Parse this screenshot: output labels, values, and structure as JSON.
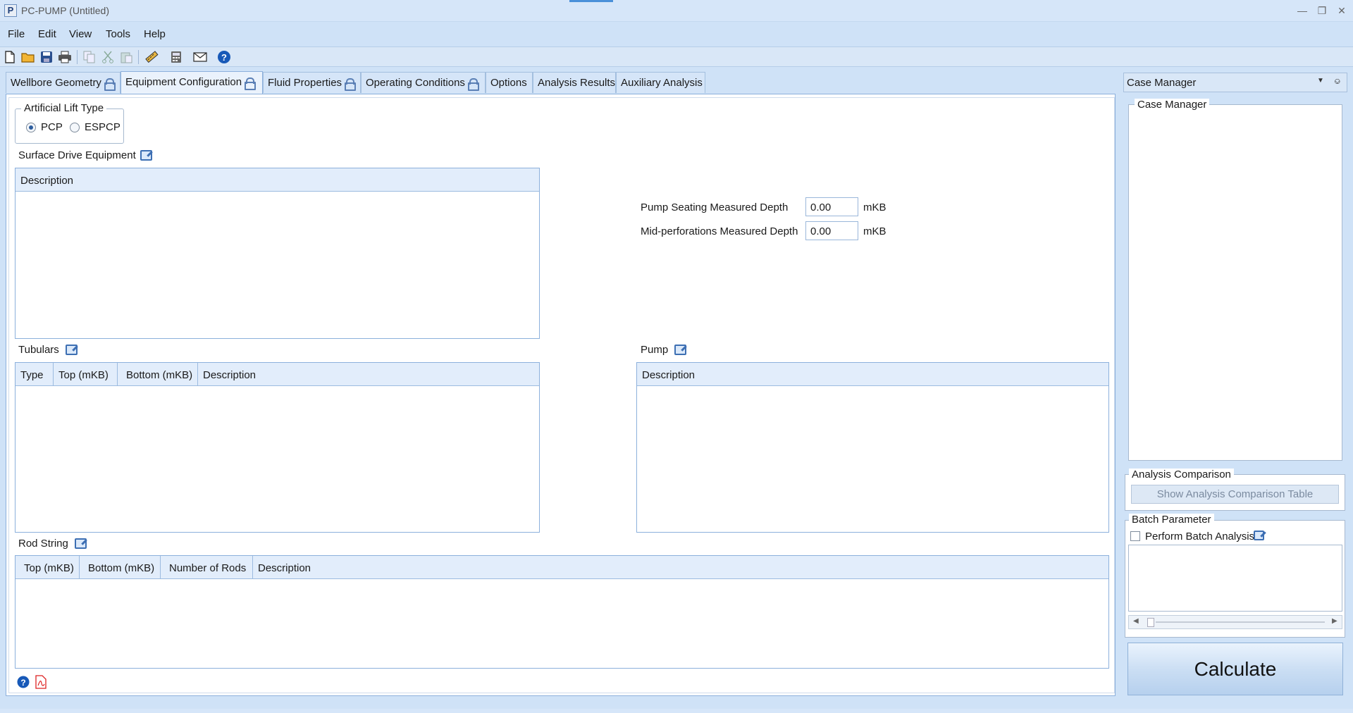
{
  "window": {
    "title": "PC-PUMP (Untitled)",
    "app_letter": "P"
  },
  "menu": [
    "File",
    "Edit",
    "View",
    "Tools",
    "Help"
  ],
  "toolbar_icons": [
    "new-file-icon",
    "open-folder-icon",
    "save-icon",
    "print-icon",
    "copy-icon",
    "cut-icon",
    "paste-icon",
    "units-icon",
    "calculator-icon",
    "email-icon",
    "help-icon"
  ],
  "tabs": [
    {
      "label": "Wellbore Geometry",
      "locked": true
    },
    {
      "label": "Equipment Configuration",
      "locked": true
    },
    {
      "label": "Fluid Properties",
      "locked": true
    },
    {
      "label": "Operating Conditions",
      "locked": true
    },
    {
      "label": "Options",
      "locked": false
    },
    {
      "label": "Analysis Results",
      "locked": false
    },
    {
      "label": "Auxiliary Analysis",
      "locked": false
    }
  ],
  "active_tab": "Equipment Configuration",
  "lift_type": {
    "title": "Artificial Lift Type",
    "options": [
      "PCP",
      "ESPCP"
    ],
    "selected": "PCP"
  },
  "surface_drive": {
    "title": "Surface Drive Equipment",
    "columns": [
      "Description"
    ]
  },
  "depths": {
    "pump_seating_label": "Pump Seating Measured Depth",
    "pump_seating_value": "0.00",
    "mid_perf_label": "Mid-perforations Measured Depth",
    "mid_perf_value": "0.00",
    "unit": "mKB"
  },
  "tubulars": {
    "title": "Tubulars",
    "columns": [
      "Type",
      "Top (mKB)",
      "Bottom (mKB)",
      "Description"
    ]
  },
  "pump": {
    "title": "Pump",
    "columns": [
      "Description"
    ]
  },
  "rod_string": {
    "title": "Rod String",
    "columns": [
      "Top (mKB)",
      "Bottom (mKB)",
      "Number of Rods",
      "Description"
    ]
  },
  "side_panel": {
    "header": "Case Manager",
    "case_manager_group": "Case Manager",
    "analysis_comparison": {
      "title": "Analysis Comparison",
      "button": "Show Analysis Comparison Table"
    },
    "batch_parameter": {
      "title": "Batch Parameter",
      "checkbox_label": "Perform Batch Analysis",
      "checked": false
    },
    "calculate_button": "Calculate"
  },
  "colors": {
    "accent": "#4a90d9",
    "background": "#cfe2f7",
    "grid_header": "#e2edfb"
  }
}
